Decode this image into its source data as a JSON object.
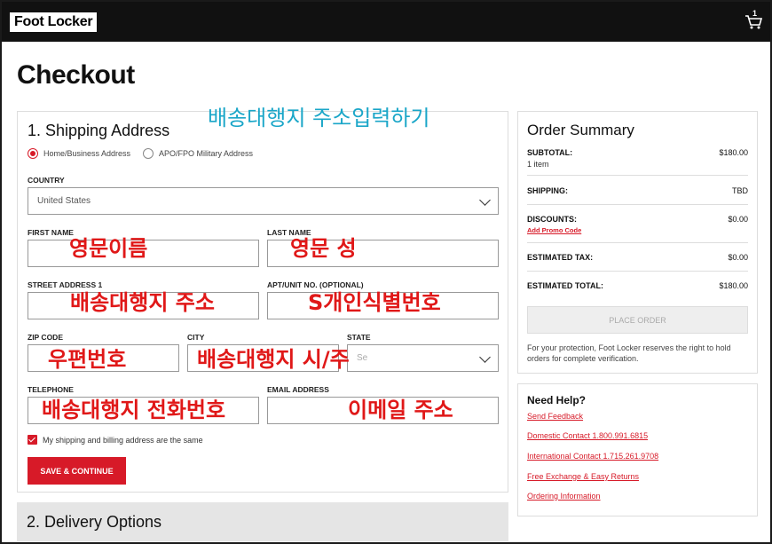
{
  "header": {
    "logo": "Foot Locker",
    "cart_count": "1"
  },
  "page_title": "Checkout",
  "shipping": {
    "title": "1. Shipping Address",
    "address_types": [
      "Home/Business Address",
      "APO/FPO Military Address"
    ],
    "country_label": "COUNTRY",
    "country_value": "United States",
    "first_name_label": "FIRST NAME",
    "last_name_label": "LAST NAME",
    "street_label": "STREET ADDRESS 1",
    "apt_label": "APT/UNIT NO. (OPTIONAL)",
    "zip_label": "ZIP CODE",
    "city_label": "CITY",
    "state_label": "STATE",
    "state_placeholder": "Se",
    "telephone_label": "TELEPHONE",
    "email_label": "EMAIL ADDRESS",
    "same_address": "My shipping and billing address are the same",
    "save_button": "SAVE & CONTINUE"
  },
  "delivery": {
    "title": "2. Delivery Options"
  },
  "summary": {
    "title": "Order Summary",
    "subtotal_label": "SUBTOTAL:",
    "subtotal_value": "$180.00",
    "item_count": "1 item",
    "shipping_label": "SHIPPING:",
    "shipping_value": "TBD",
    "discounts_label": "DISCOUNTS:",
    "discounts_value": "$0.00",
    "promo_link": "Add Promo Code",
    "tax_label": "ESTIMATED TAX:",
    "tax_value": "$0.00",
    "total_label": "ESTIMATED TOTAL:",
    "total_value": "$180.00",
    "place_order": "PLACE ORDER",
    "protection_note": "For your protection, Foot Locker reserves the right to hold orders for complete verification."
  },
  "help": {
    "title": "Need Help?",
    "links": [
      "Send Feedback",
      "Domestic Contact 1.800.991.6815",
      "International Contact 1.715.261.9708",
      "Free Exchange & Easy Returns",
      "Ordering Information"
    ]
  },
  "annotations": {
    "heading": "배송대행지 주소입력하기",
    "first_name": "영문이름",
    "last_name": "영문 성",
    "street": "배송대행지 주소",
    "apt": "S개인식별번호",
    "zip": "우편번호",
    "city_state": "배송대행지 시/주",
    "telephone": "배송대행지 전화번호",
    "email": "이메일 주소"
  }
}
